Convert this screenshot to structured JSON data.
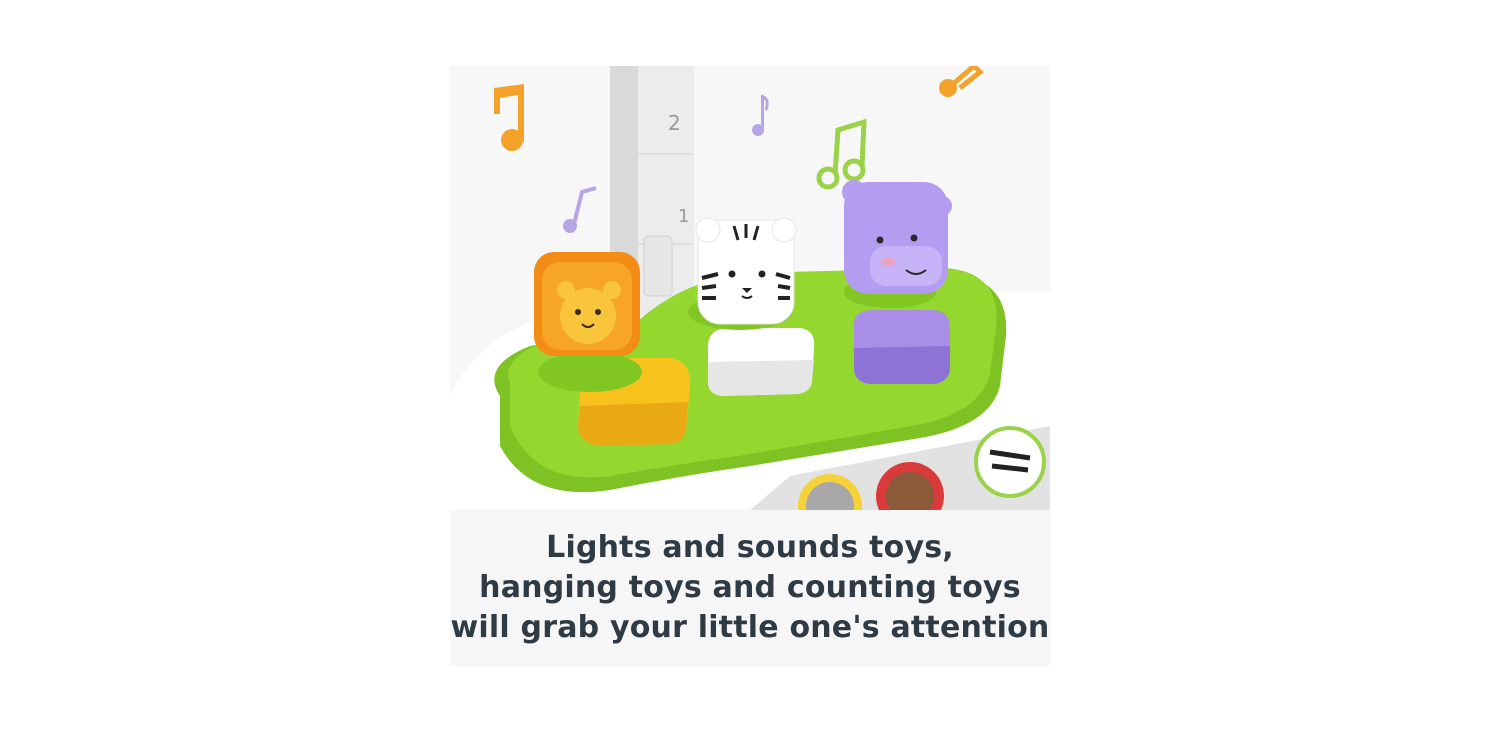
{
  "product_image": {
    "alt_icons": [
      "music-note-icon",
      "lion-toy-icon",
      "tiger-toy-icon",
      "hippo-toy-icon"
    ],
    "pole_numbers": [
      "2",
      "1"
    ],
    "colors": {
      "tray_green": "#8fd42c",
      "lion_orange": "#f59c1a",
      "button_yellow": "#f7c21c",
      "hippo_purple": "#a98ee8",
      "note_orange": "#f5a22a",
      "note_purple": "#b7a6e6",
      "note_green": "#9ad24a",
      "caption_text": "#2f3b44"
    }
  },
  "caption": {
    "line1": "Lights and sounds toys,",
    "line2": "hanging toys and counting toys",
    "line3": "will grab your little one's attention"
  }
}
